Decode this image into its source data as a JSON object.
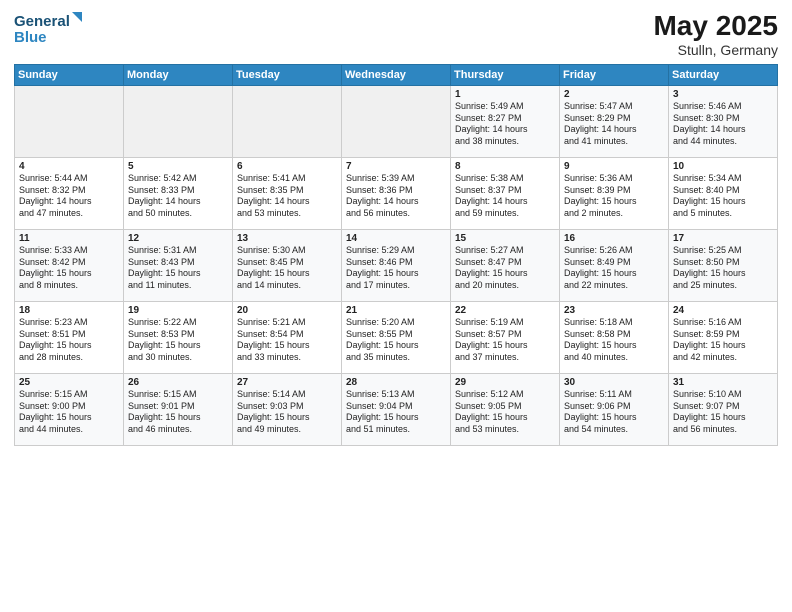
{
  "logo": {
    "line1": "General",
    "line2": "Blue"
  },
  "title": {
    "month_year": "May 2025",
    "location": "Stulln, Germany"
  },
  "weekdays": [
    "Sunday",
    "Monday",
    "Tuesday",
    "Wednesday",
    "Thursday",
    "Friday",
    "Saturday"
  ],
  "weeks": [
    [
      {
        "day": "",
        "content": ""
      },
      {
        "day": "",
        "content": ""
      },
      {
        "day": "",
        "content": ""
      },
      {
        "day": "",
        "content": ""
      },
      {
        "day": "1",
        "content": "Sunrise: 5:49 AM\nSunset: 8:27 PM\nDaylight: 14 hours\nand 38 minutes."
      },
      {
        "day": "2",
        "content": "Sunrise: 5:47 AM\nSunset: 8:29 PM\nDaylight: 14 hours\nand 41 minutes."
      },
      {
        "day": "3",
        "content": "Sunrise: 5:46 AM\nSunset: 8:30 PM\nDaylight: 14 hours\nand 44 minutes."
      }
    ],
    [
      {
        "day": "4",
        "content": "Sunrise: 5:44 AM\nSunset: 8:32 PM\nDaylight: 14 hours\nand 47 minutes."
      },
      {
        "day": "5",
        "content": "Sunrise: 5:42 AM\nSunset: 8:33 PM\nDaylight: 14 hours\nand 50 minutes."
      },
      {
        "day": "6",
        "content": "Sunrise: 5:41 AM\nSunset: 8:35 PM\nDaylight: 14 hours\nand 53 minutes."
      },
      {
        "day": "7",
        "content": "Sunrise: 5:39 AM\nSunset: 8:36 PM\nDaylight: 14 hours\nand 56 minutes."
      },
      {
        "day": "8",
        "content": "Sunrise: 5:38 AM\nSunset: 8:37 PM\nDaylight: 14 hours\nand 59 minutes."
      },
      {
        "day": "9",
        "content": "Sunrise: 5:36 AM\nSunset: 8:39 PM\nDaylight: 15 hours\nand 2 minutes."
      },
      {
        "day": "10",
        "content": "Sunrise: 5:34 AM\nSunset: 8:40 PM\nDaylight: 15 hours\nand 5 minutes."
      }
    ],
    [
      {
        "day": "11",
        "content": "Sunrise: 5:33 AM\nSunset: 8:42 PM\nDaylight: 15 hours\nand 8 minutes."
      },
      {
        "day": "12",
        "content": "Sunrise: 5:31 AM\nSunset: 8:43 PM\nDaylight: 15 hours\nand 11 minutes."
      },
      {
        "day": "13",
        "content": "Sunrise: 5:30 AM\nSunset: 8:45 PM\nDaylight: 15 hours\nand 14 minutes."
      },
      {
        "day": "14",
        "content": "Sunrise: 5:29 AM\nSunset: 8:46 PM\nDaylight: 15 hours\nand 17 minutes."
      },
      {
        "day": "15",
        "content": "Sunrise: 5:27 AM\nSunset: 8:47 PM\nDaylight: 15 hours\nand 20 minutes."
      },
      {
        "day": "16",
        "content": "Sunrise: 5:26 AM\nSunset: 8:49 PM\nDaylight: 15 hours\nand 22 minutes."
      },
      {
        "day": "17",
        "content": "Sunrise: 5:25 AM\nSunset: 8:50 PM\nDaylight: 15 hours\nand 25 minutes."
      }
    ],
    [
      {
        "day": "18",
        "content": "Sunrise: 5:23 AM\nSunset: 8:51 PM\nDaylight: 15 hours\nand 28 minutes."
      },
      {
        "day": "19",
        "content": "Sunrise: 5:22 AM\nSunset: 8:53 PM\nDaylight: 15 hours\nand 30 minutes."
      },
      {
        "day": "20",
        "content": "Sunrise: 5:21 AM\nSunset: 8:54 PM\nDaylight: 15 hours\nand 33 minutes."
      },
      {
        "day": "21",
        "content": "Sunrise: 5:20 AM\nSunset: 8:55 PM\nDaylight: 15 hours\nand 35 minutes."
      },
      {
        "day": "22",
        "content": "Sunrise: 5:19 AM\nSunset: 8:57 PM\nDaylight: 15 hours\nand 37 minutes."
      },
      {
        "day": "23",
        "content": "Sunrise: 5:18 AM\nSunset: 8:58 PM\nDaylight: 15 hours\nand 40 minutes."
      },
      {
        "day": "24",
        "content": "Sunrise: 5:16 AM\nSunset: 8:59 PM\nDaylight: 15 hours\nand 42 minutes."
      }
    ],
    [
      {
        "day": "25",
        "content": "Sunrise: 5:15 AM\nSunset: 9:00 PM\nDaylight: 15 hours\nand 44 minutes."
      },
      {
        "day": "26",
        "content": "Sunrise: 5:15 AM\nSunset: 9:01 PM\nDaylight: 15 hours\nand 46 minutes."
      },
      {
        "day": "27",
        "content": "Sunrise: 5:14 AM\nSunset: 9:03 PM\nDaylight: 15 hours\nand 49 minutes."
      },
      {
        "day": "28",
        "content": "Sunrise: 5:13 AM\nSunset: 9:04 PM\nDaylight: 15 hours\nand 51 minutes."
      },
      {
        "day": "29",
        "content": "Sunrise: 5:12 AM\nSunset: 9:05 PM\nDaylight: 15 hours\nand 53 minutes."
      },
      {
        "day": "30",
        "content": "Sunrise: 5:11 AM\nSunset: 9:06 PM\nDaylight: 15 hours\nand 54 minutes."
      },
      {
        "day": "31",
        "content": "Sunrise: 5:10 AM\nSunset: 9:07 PM\nDaylight: 15 hours\nand 56 minutes."
      }
    ]
  ]
}
